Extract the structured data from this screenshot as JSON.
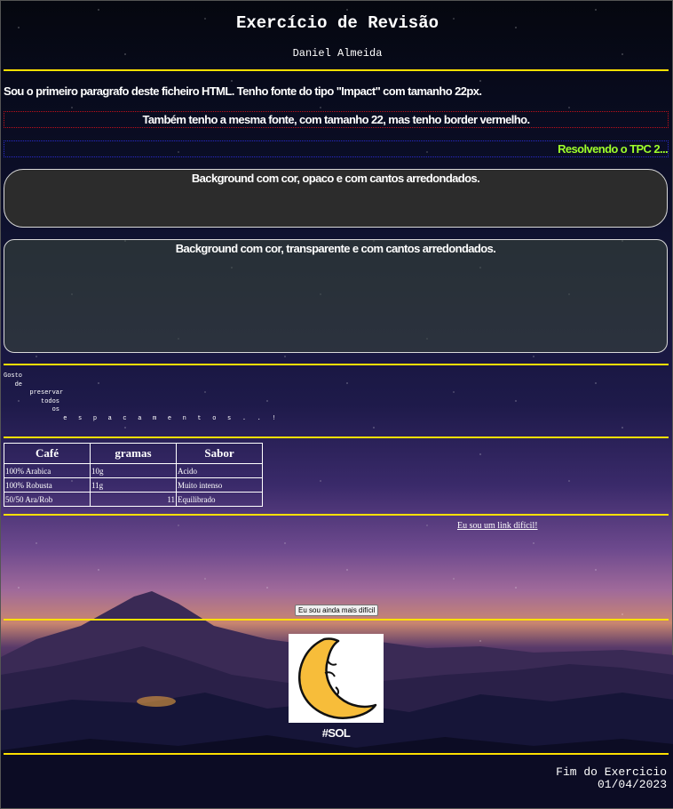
{
  "header": {
    "title": "Exercício de Revisão",
    "author": "Daniel Almeida"
  },
  "paragraphs": {
    "impact": "Sou o primeiro paragrafo deste ficheiro HTML. Tenho fonte do tipo \"Impact\" com tamanho 22px.",
    "red_border": "Também tenho a mesma fonte, com tamanho 22, mas tenho border vermelho.",
    "tpc": "Resolvendo o TPC 2..."
  },
  "boxes": {
    "opaque": "Background com cor, opaco e com cantos arredondados.",
    "transparent": "Background com cor, transparente e com cantos arredondados."
  },
  "preformatted": "Gosto\n   de\n       preservar\n          todos\n             os\n                e   s   p   a   c   a   m   e   n   t   o   s   .   .   !",
  "table": {
    "headers": [
      "Café",
      "gramas",
      "Sabor"
    ],
    "rows": [
      [
        "100% Arabica",
        "10g",
        "Acido"
      ],
      [
        "100% Robusta",
        "11g",
        "Muito intenso"
      ],
      [
        "50/50 Ara/Rob",
        "11",
        "Equilibrado"
      ]
    ]
  },
  "link_label": "Eu sou um link difícil!",
  "button_label": "Eu sou ainda mais difícil",
  "image": {
    "caption": "#SOL",
    "icon": "crescent-moon-face"
  },
  "footer": {
    "line1": "Fim do Exercicio",
    "date": "01/04/2023"
  },
  "colors": {
    "rule": "#ffe000",
    "tpc_text": "#9fff2a",
    "red_border": "#c0101a",
    "blue_border": "#2a2acc"
  }
}
